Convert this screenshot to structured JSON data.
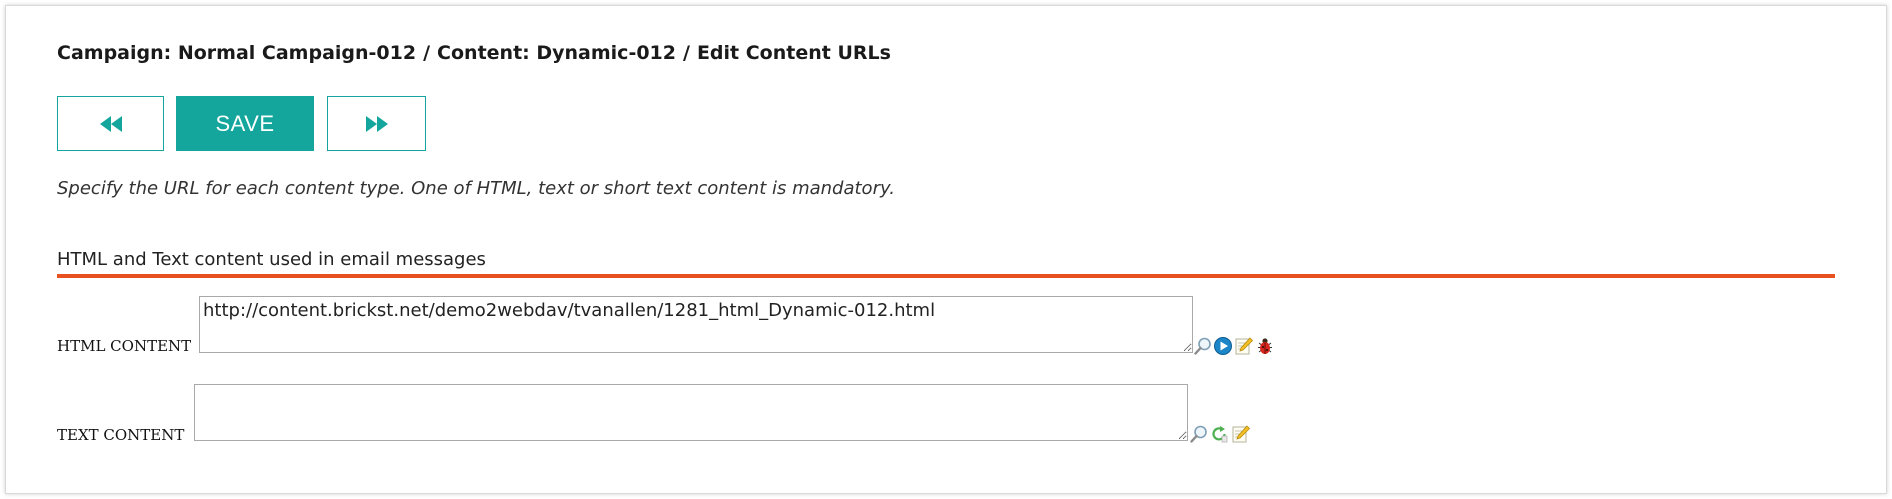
{
  "breadcrumb": {
    "campaign": "Campaign: Normal Campaign-012",
    "separator1": "/",
    "content": "Content: Dynamic-012",
    "separator2": "/",
    "page": "Edit Content URLs"
  },
  "toolbar": {
    "prev_icon": "rewind-icon",
    "save_label": "SAVE",
    "next_icon": "fast-forward-icon",
    "accent_color": "#14a69c"
  },
  "hint": "Specify the URL for each content type. One of HTML, text or short text content is mandatory.",
  "section": {
    "title": "HTML and Text content used in email messages",
    "rule_color": "#e8501f"
  },
  "fields": {
    "html": {
      "label": "HTML CONTENT",
      "value": "http://content.brickst.net/demo2webdav/tvanallen/1281_html_Dynamic-012.html",
      "icons": [
        "magnifier-icon",
        "play-icon",
        "edit-icon",
        "bug-icon"
      ]
    },
    "text": {
      "label": "TEXT CONTENT",
      "value": "",
      "icons": [
        "magnifier-icon",
        "refresh-icon",
        "edit-icon"
      ]
    }
  }
}
